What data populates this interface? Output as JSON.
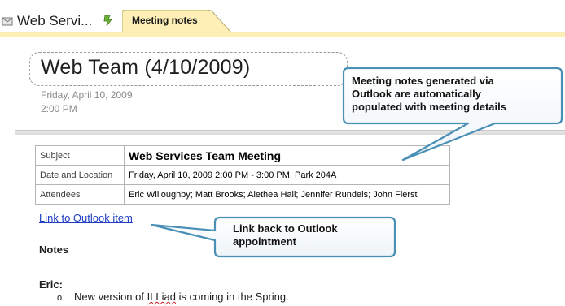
{
  "tabs": {
    "web_tab_label": "Web Servi...",
    "active_tab_label": "Meeting notes"
  },
  "page": {
    "title": "Web Team (4/10/2009)",
    "date": "Friday, April 10, 2009",
    "time": "2:00 PM"
  },
  "meeting_table": [
    {
      "key": "Subject",
      "value": "Web Services Team Meeting"
    },
    {
      "key": "Date and Location",
      "value": "Friday, April 10, 2009 2:00 PM - 3:00 PM, Park 204A"
    },
    {
      "key": "Attendees",
      "value": "Eric Willoughby; Matt Brooks; Alethea Hall; Jennifer Rundels; John Fierst"
    }
  ],
  "outlook_link": "Link to Outlook item",
  "notes": {
    "heading": "Notes",
    "person": "Eric:",
    "bullet_glyph": "o",
    "item_before": "New version of ",
    "item_misspelled": "ILLiad",
    "item_after": " is coming in the Spring."
  },
  "callouts": {
    "top_lines": [
      "Meeting notes generated via",
      "Outlook are automatically",
      "populated with meeting details"
    ],
    "bottom_lines": [
      "Link back to Outlook",
      "appointment"
    ]
  },
  "colors": {
    "callout_border": "#4a8fb5",
    "link": "#1f3ec4",
    "active_tab": "#fdefb6"
  }
}
